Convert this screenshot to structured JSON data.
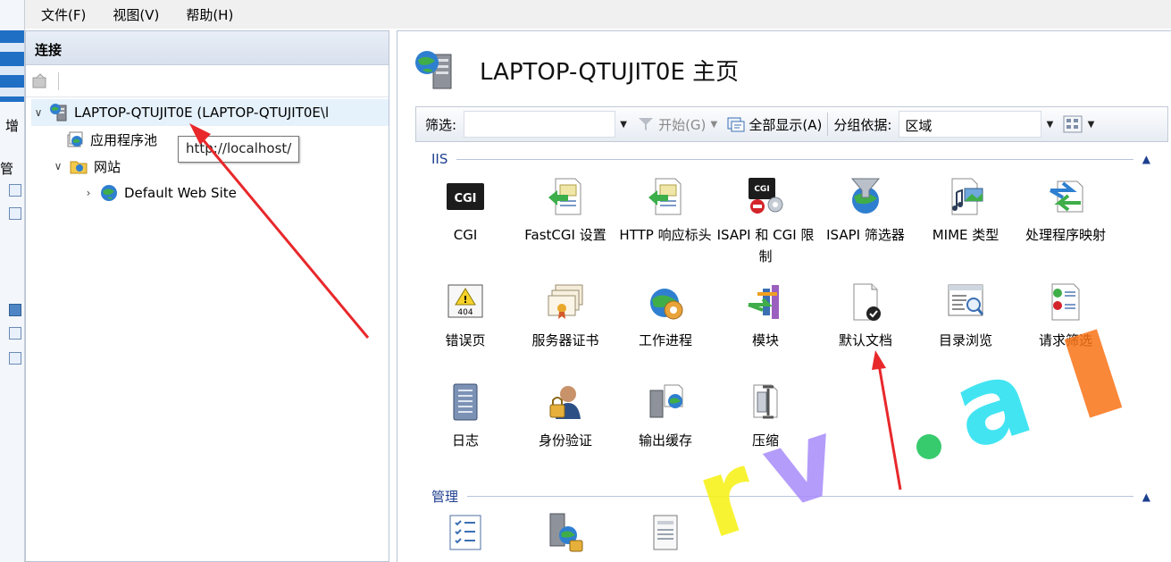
{
  "menu": [
    {
      "label": "文件(F)",
      "key": "F"
    },
    {
      "label": "视图(V)",
      "key": "V"
    },
    {
      "label": "帮助(H)",
      "key": "H"
    }
  ],
  "background_window": {
    "labels": [
      "增",
      "管"
    ]
  },
  "connections": {
    "title": "连接",
    "tree": [
      {
        "label": "LAPTOP-QTUJIT0E (LAPTOP-QTUJIT0E\\l",
        "selected": true,
        "expanded": true
      },
      {
        "label": "应用程序池"
      },
      {
        "label": "网站",
        "expanded": true
      },
      {
        "label": "Default Web Site",
        "expanded": false
      }
    ],
    "tooltip": "http://localhost/"
  },
  "main": {
    "title": "LAPTOP-QTUJIT0E 主页",
    "filter": {
      "label": "筛选:",
      "value": "",
      "start": "开始(G)",
      "show_all": "全部显示(A)",
      "group_by_label": "分组依据:",
      "group_by_value": "区域"
    },
    "groups": [
      {
        "name": "IIS",
        "features": [
          {
            "label": "CGI",
            "icon": "cgi-icon"
          },
          {
            "label": "FastCGI 设置",
            "icon": "fastcgi-icon"
          },
          {
            "label": "HTTP 响应标头",
            "icon": "http-headers-icon"
          },
          {
            "label": "ISAPI 和 CGI 限制",
            "icon": "isapi-cgi-restrictions-icon"
          },
          {
            "label": "ISAPI 筛选器",
            "icon": "isapi-filters-icon"
          },
          {
            "label": "MIME 类型",
            "icon": "mime-types-icon"
          },
          {
            "label": "处理程序映射",
            "icon": "handler-mappings-icon"
          },
          {
            "label": "错误页",
            "icon": "error-pages-icon"
          },
          {
            "label": "服务器证书",
            "icon": "server-certificates-icon"
          },
          {
            "label": "工作进程",
            "icon": "worker-processes-icon"
          },
          {
            "label": "模块",
            "icon": "modules-icon"
          },
          {
            "label": "默认文档",
            "icon": "default-document-icon"
          },
          {
            "label": "目录浏览",
            "icon": "directory-browsing-icon"
          },
          {
            "label": "请求筛选",
            "icon": "request-filtering-icon"
          },
          {
            "label": "日志",
            "icon": "logging-icon"
          },
          {
            "label": "身份验证",
            "icon": "authentication-icon"
          },
          {
            "label": "输出缓存",
            "icon": "output-caching-icon"
          },
          {
            "label": "压缩",
            "icon": "compression-icon"
          }
        ]
      },
      {
        "name": "管理",
        "features": [
          {
            "label": "",
            "icon": "configuration-editor-icon"
          },
          {
            "label": "",
            "icon": "feature-delegation-icon"
          },
          {
            "label": "",
            "icon": "shared-configuration-icon"
          }
        ]
      }
    ]
  },
  "watermark": {
    "text": "rv.al",
    "colors": [
      "#f7f21e",
      "#a78bfa",
      "#22c55e",
      "#22e0f0",
      "#f97316"
    ]
  },
  "annotation_color": "#e8282b"
}
